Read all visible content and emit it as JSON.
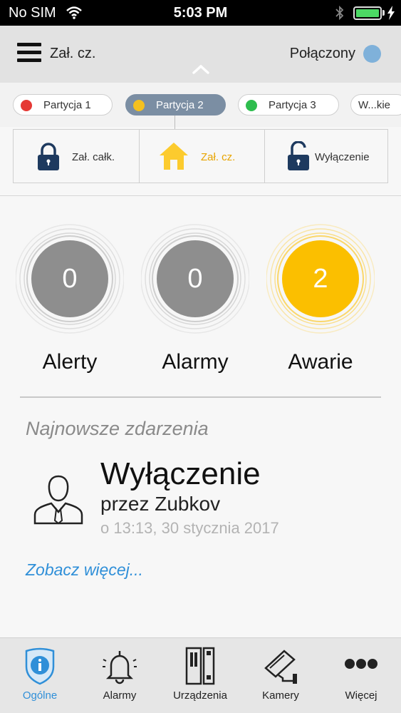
{
  "status_bar": {
    "carrier": "No SIM",
    "time": "5:03 PM",
    "battery_level": 1.0
  },
  "header": {
    "mode_title": "Zał. cz.",
    "connection_label": "Połączony",
    "connection_color": "#7fb1da",
    "menu_icon": "hamburger-menu-icon",
    "collapse_icon": "chevron-up-icon"
  },
  "partitions": [
    {
      "label": "Partycja 1",
      "color": "#e53935",
      "selected": false
    },
    {
      "label": "Partycja 2",
      "color": "#f4c01e",
      "selected": true
    },
    {
      "label": "Partycja 3",
      "color": "#2ebd4e",
      "selected": false
    },
    {
      "label": "W...kie",
      "color": "",
      "selected": false
    }
  ],
  "arm_modes": [
    {
      "label": "Zał. całk.",
      "icon": "lock-closed-icon",
      "active": false
    },
    {
      "label": "Zał. cz.",
      "icon": "home-icon",
      "active": true
    },
    {
      "label": "Wyłączenie",
      "icon": "lock-open-icon",
      "active": false
    }
  ],
  "counters": [
    {
      "label": "Alerty",
      "value": "0",
      "color": "#8e8e8e"
    },
    {
      "label": "Alarmy",
      "value": "0",
      "color": "#8e8e8e"
    },
    {
      "label": "Awarie",
      "value": "2",
      "color": "#fbbf00"
    }
  ],
  "events": {
    "section_title": "Najnowsze zdarzenia",
    "latest": {
      "title": "Wyłączenie",
      "user": "przez Zubkov",
      "time": "o 13:13, 30 stycznia 2017",
      "icon": "user-avatar-icon"
    },
    "see_more": "Zobacz więcej..."
  },
  "tabs": [
    {
      "label": "Ogólne",
      "icon": "info-shield-icon",
      "active": true
    },
    {
      "label": "Alarmy",
      "icon": "bell-icon",
      "active": false
    },
    {
      "label": "Urządzenia",
      "icon": "devices-icon",
      "active": false
    },
    {
      "label": "Kamery",
      "icon": "camera-icon",
      "active": false
    },
    {
      "label": "Więcej",
      "icon": "more-dots-icon",
      "active": false
    }
  ],
  "colors": {
    "accent": "#2f8fd8",
    "active_mode": "#e8a400",
    "lock_icon": "#1e3a5f"
  }
}
